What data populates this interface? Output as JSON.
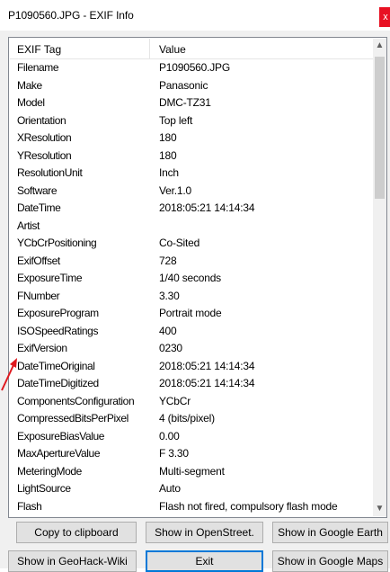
{
  "window": {
    "title": "P1090560.JPG - EXIF Info",
    "close_label": "x"
  },
  "table": {
    "headers": {
      "tag": "EXIF Tag",
      "value": "Value"
    },
    "rows": [
      {
        "tag": "Filename",
        "value": "P1090560.JPG"
      },
      {
        "tag": "Make",
        "value": "Panasonic"
      },
      {
        "tag": "Model",
        "value": "DMC-TZ31"
      },
      {
        "tag": "Orientation",
        "value": "Top left"
      },
      {
        "tag": "XResolution",
        "value": "180"
      },
      {
        "tag": "YResolution",
        "value": "180"
      },
      {
        "tag": "ResolutionUnit",
        "value": "Inch"
      },
      {
        "tag": "Software",
        "value": "Ver.1.0"
      },
      {
        "tag": "DateTime",
        "value": "2018:05:21 14:14:34"
      },
      {
        "tag": "Artist",
        "value": ""
      },
      {
        "tag": "YCbCrPositioning",
        "value": "Co-Sited"
      },
      {
        "tag": "ExifOffset",
        "value": "728"
      },
      {
        "tag": "ExposureTime",
        "value": "1/40 seconds"
      },
      {
        "tag": "FNumber",
        "value": "3.30"
      },
      {
        "tag": "ExposureProgram",
        "value": "Portrait mode"
      },
      {
        "tag": "ISOSpeedRatings",
        "value": "400"
      },
      {
        "tag": "ExifVersion",
        "value": "0230"
      },
      {
        "tag": "DateTimeOriginal",
        "value": "2018:05:21 14:14:34"
      },
      {
        "tag": "DateTimeDigitized",
        "value": "2018:05:21 14:14:34"
      },
      {
        "tag": "ComponentsConfiguration",
        "value": "YCbCr"
      },
      {
        "tag": "CompressedBitsPerPixel",
        "value": "4 (bits/pixel)"
      },
      {
        "tag": "ExposureBiasValue",
        "value": "0.00"
      },
      {
        "tag": "MaxApertureValue",
        "value": "F 3.30"
      },
      {
        "tag": "MeteringMode",
        "value": "Multi-segment"
      },
      {
        "tag": "LightSource",
        "value": "Auto"
      },
      {
        "tag": "Flash",
        "value": "Flash not fired, compulsory flash mode"
      }
    ]
  },
  "buttons": {
    "copy": "Copy to clipboard",
    "openstreet": "Show in OpenStreet.",
    "google_earth": "Show in Google Earth",
    "geohack": "Show in GeoHack-Wiki",
    "exit": "Exit",
    "google_maps": "Show in Google Maps"
  },
  "icons": {
    "scroll_up": "chevron-up-icon",
    "scroll_down": "chevron-down-icon",
    "annotation": "red-arrow"
  },
  "colors": {
    "close_button": "#e81123",
    "default_button_border": "#0078d7",
    "annotation_arrow": "#e0191f"
  }
}
